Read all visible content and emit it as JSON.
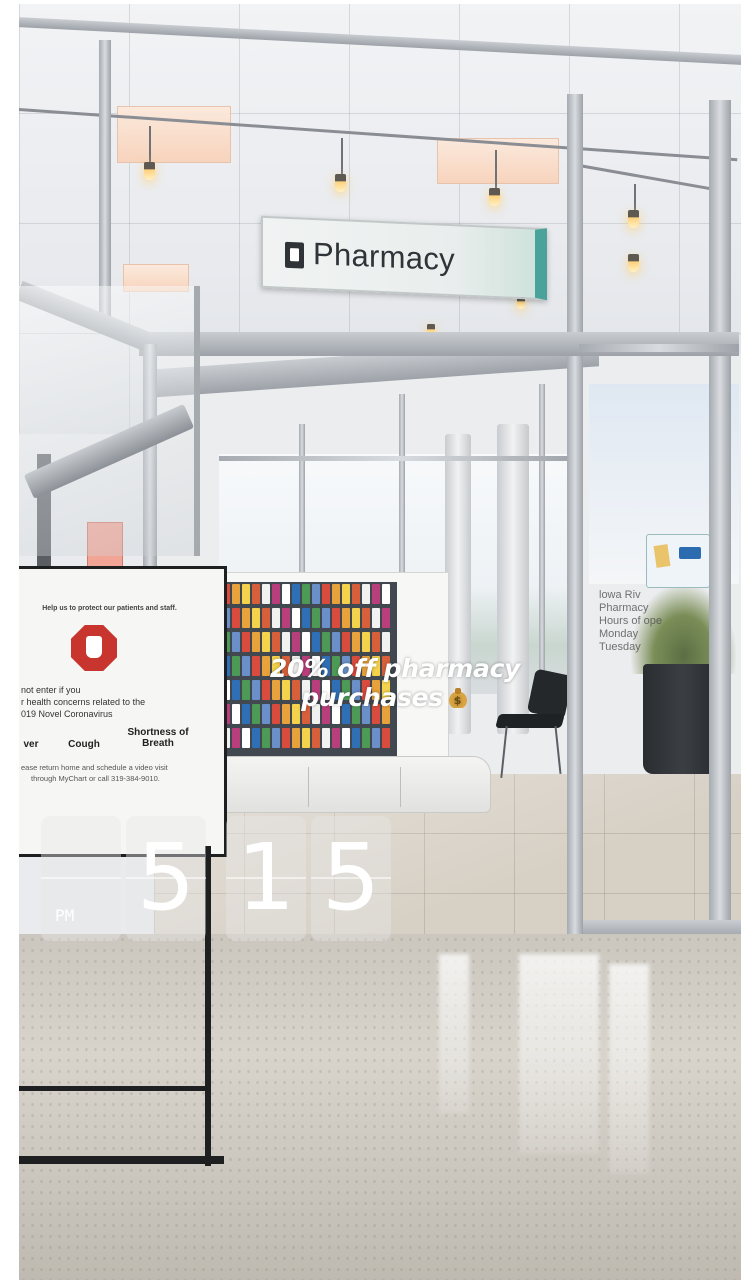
{
  "sign": {
    "label": "Pharmacy",
    "icon": "pharmacy-icon"
  },
  "stand_sign": {
    "heading": "Help us to protect our patients and staff.",
    "lines": [
      "not enter if you",
      "r health concerns related to the",
      "019 Novel Coronavirus"
    ],
    "symptoms": [
      "ver",
      "Cough",
      "Shortness of Breath"
    ],
    "footer": [
      "ease return home and schedule a video visit",
      "through MyChart or call 319-384-9010."
    ],
    "stop_color": "#c8352e"
  },
  "window_text": [
    "lowa Riv",
    "Pharmacy",
    "Hours of ope",
    "Monday",
    "Tuesday"
  ],
  "story": {
    "caption_line1": "20% off pharmacy",
    "caption_line2": "purchases",
    "caption_emoji": "money-bag-icon"
  },
  "clock_sticker": {
    "ampm": "PM",
    "hour_tens": "",
    "hour_ones": "5",
    "minute_tens": "1",
    "minute_ones": "5"
  }
}
